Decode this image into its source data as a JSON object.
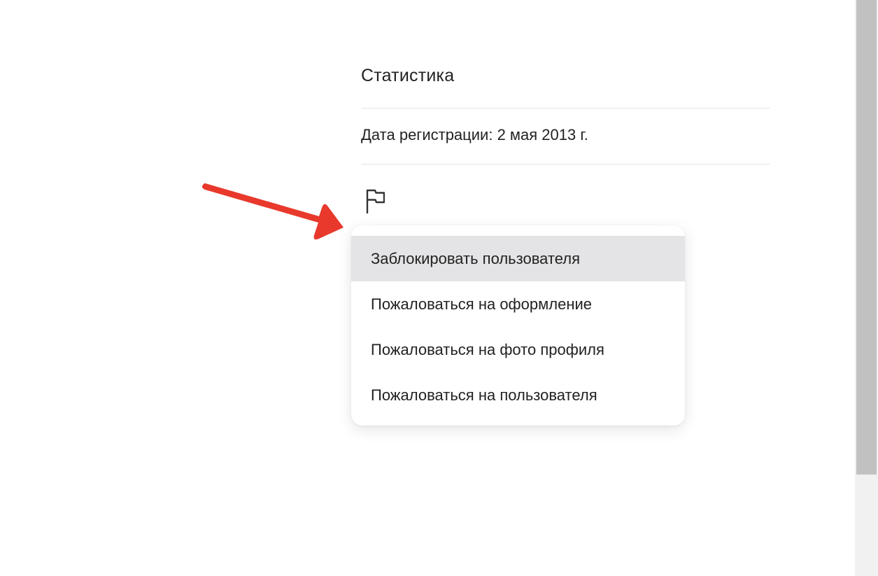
{
  "profile": {
    "stats_title": "Статистика",
    "registration_date": "Дата регистрации: 2 мая 2013 г."
  },
  "report_button": {
    "icon": "flag-icon"
  },
  "report_menu": {
    "items": [
      {
        "label": "Заблокировать пользователя",
        "highlighted": true
      },
      {
        "label": "Пожаловаться на оформление",
        "highlighted": false
      },
      {
        "label": "Пожаловаться на фото профиля",
        "highlighted": false
      },
      {
        "label": "Пожаловаться на пользователя",
        "highlighted": false
      }
    ]
  },
  "annotation": {
    "icon": "arrow-icon",
    "color": "#e8392c"
  },
  "colors": {
    "menu_highlight": "#e4e4e6",
    "scrollbar_thumb": "#c1c1c1",
    "text": "#222222"
  }
}
